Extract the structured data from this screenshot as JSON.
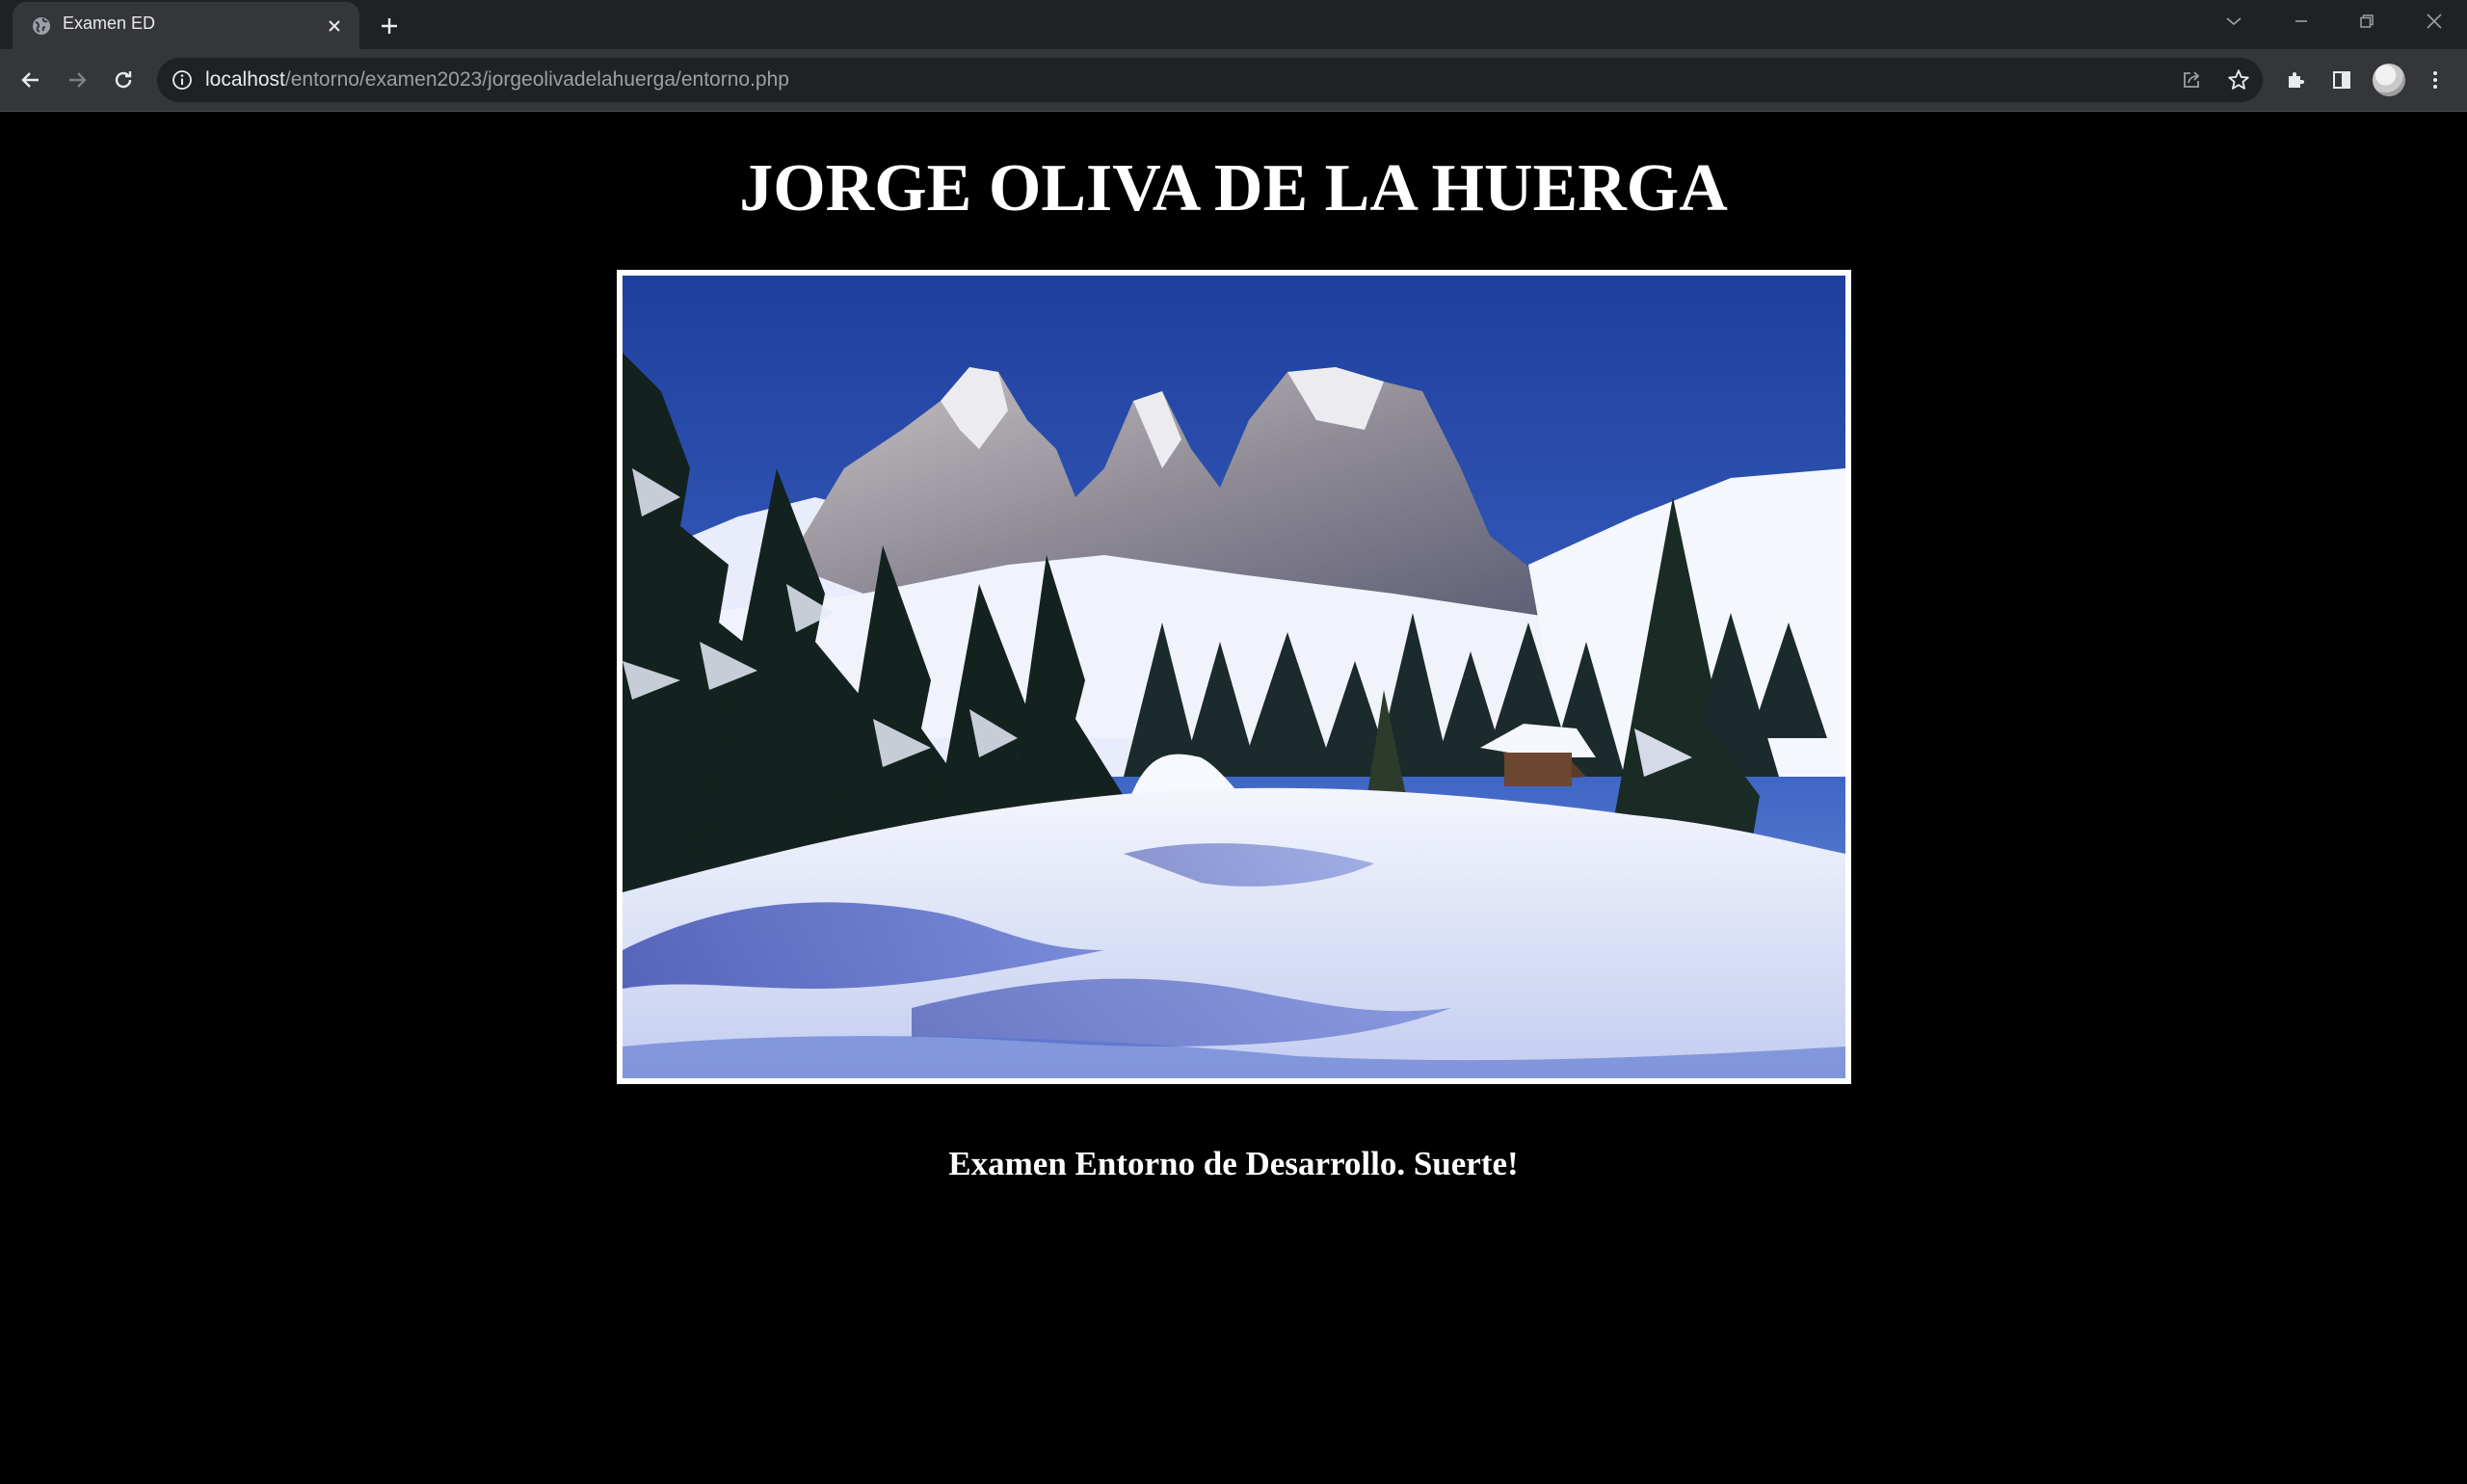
{
  "browser": {
    "tab": {
      "title": "Examen ED",
      "favicon": "globe-icon"
    },
    "address_bar": {
      "host": "localhost",
      "path": "/entorno/examen2023/jorgeolivadelahuerga/entorno.php"
    },
    "colors": {
      "tabstrip": "#202124",
      "toolbar": "#35363a",
      "omnibox": "#202124",
      "text": "#e8eaed"
    }
  },
  "page": {
    "title": "JORGE OLIVA DE LA HUERGA",
    "image": {
      "subject": "snowy-mountain-landscape",
      "border_color": "#ffffff"
    },
    "caption": "Examen Entorno de Desarrollo. Suerte!",
    "background": "#000000"
  }
}
